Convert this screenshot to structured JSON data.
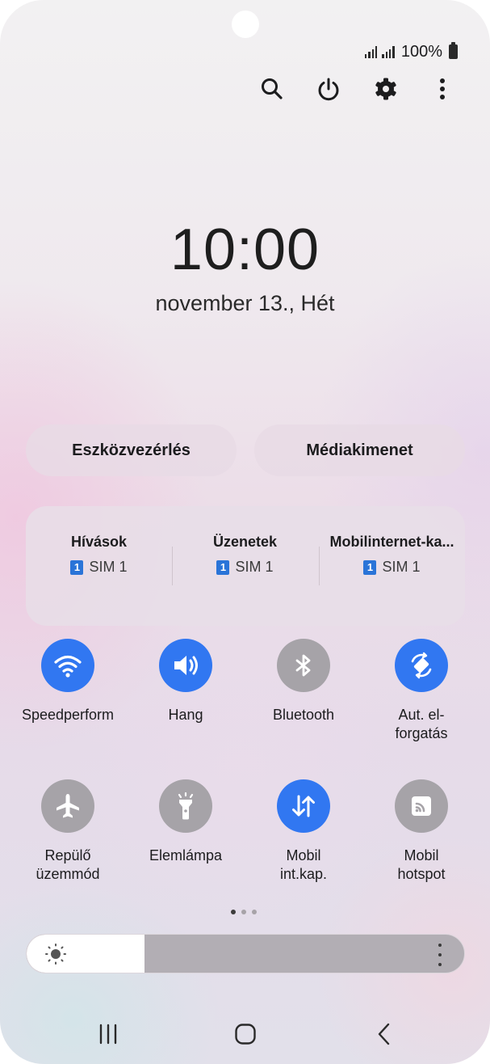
{
  "status_bar": {
    "battery_percent": "100%",
    "icons": [
      "signal-icon",
      "signal-icon",
      "battery-icon"
    ]
  },
  "top_actions": {
    "icons": [
      "search-icon",
      "power-icon",
      "gear-icon",
      "more-options-icon"
    ]
  },
  "clock": {
    "time": "10:00",
    "date": "november 13., Hét"
  },
  "shortcuts": {
    "device_control": "Eszközvezérlés",
    "media_output": "Médiakimenet"
  },
  "sim_settings": [
    {
      "title": "Hívások",
      "sim_badge": "1",
      "sim": "SIM 1"
    },
    {
      "title": "Üzenetek",
      "sim_badge": "1",
      "sim": "SIM 1"
    },
    {
      "title": "Mobilinternet-ka...",
      "sim_badge": "1",
      "sim": "SIM 1"
    }
  ],
  "quick_tiles": [
    {
      "label": "Speedperform",
      "icon": "wifi-icon",
      "active": true
    },
    {
      "label": "Hang",
      "icon": "sound-icon",
      "active": true
    },
    {
      "label": "Bluetooth",
      "icon": "bluetooth-icon",
      "active": false
    },
    {
      "label": "Aut. el-\nforgatás",
      "icon": "auto-rotate-icon",
      "active": true
    },
    {
      "label": "Repülő\nüzemmód",
      "icon": "airplane-icon",
      "active": false
    },
    {
      "label": "Elemlámpa",
      "icon": "flashlight-icon",
      "active": false
    },
    {
      "label": "Mobil\nint.kap.",
      "icon": "mobile-data-icon",
      "active": true
    },
    {
      "label": "Mobil\nhotspot",
      "icon": "hotspot-icon",
      "active": false
    }
  ],
  "pager": {
    "pages": 3,
    "current": 1
  },
  "brightness": {
    "level_percent": 27
  },
  "colors": {
    "active_tile": "#3177f1",
    "inactive_tile": "#a6a3a8",
    "sim_badge": "#2a74d8"
  },
  "nav_bar": {
    "icons": [
      "recent-apps-icon",
      "home-icon",
      "back-icon"
    ]
  }
}
